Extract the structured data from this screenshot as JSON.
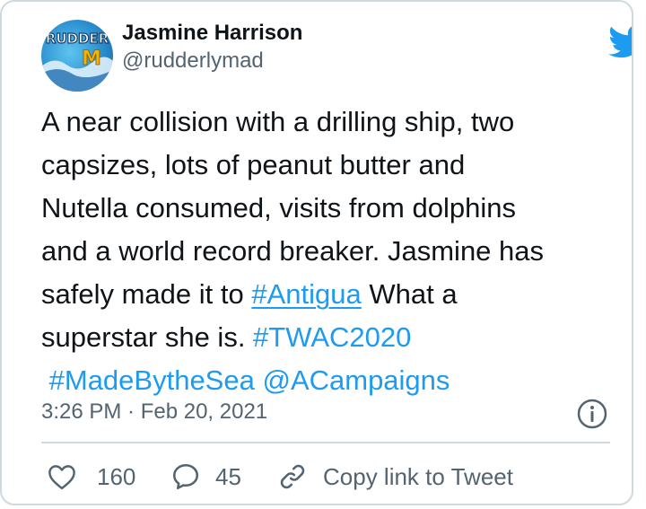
{
  "author": {
    "name": "Jasmine Harrison",
    "handle": "@rudderlymad",
    "avatar_logo_text": "RUDDERLY MAD"
  },
  "tweet": {
    "lines": [
      [
        "A near collision with a drilling ship, two"
      ],
      [
        "capsizes, lots of peanut butter and"
      ],
      [
        "Nutella consumed, visits from dolphins"
      ],
      [
        "and a world record breaker. Jasmine has"
      ],
      [
        "safely made it to ",
        "#Antigua",
        " What a"
      ],
      [
        "superstar she is. ",
        "#TWAC2020"
      ],
      [
        " ",
        "#MadeBytheSea",
        " ",
        "@ACampaigns"
      ]
    ]
  },
  "meta": {
    "timestamp": "3:26 PM · Feb 20, 2021"
  },
  "actions": {
    "like_count": "160",
    "reply_count": "45",
    "copy_link_label": "Copy link to Tweet"
  },
  "colors": {
    "link": "#1d9bf0",
    "text": "#0f1419",
    "muted": "#536471",
    "border": "#cfd9de",
    "twitter_blue": "#1d9bf0"
  },
  "icons": {
    "brand": "twitter-bird-icon",
    "info": "info-icon",
    "like": "heart-icon",
    "reply": "reply-bubble-icon",
    "copy": "link-icon"
  }
}
